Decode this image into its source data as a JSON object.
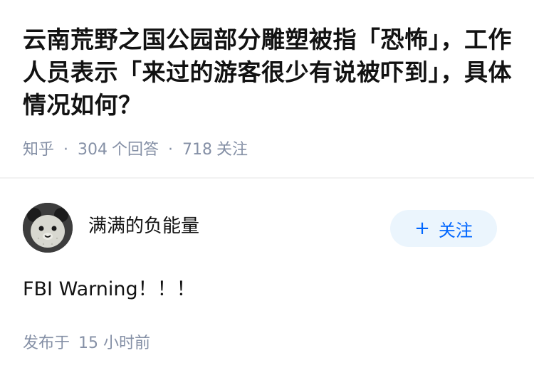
{
  "question": {
    "title": "云南荒野之国公园部分雕塑被指「恐怖」，工作人员表示「来过的游客很少有说被吓到」，具体情况如何？",
    "source": "知乎",
    "separator": "·",
    "answer_count": "304",
    "answer_label": "个回答",
    "follower_count": "718",
    "follower_label": "关注"
  },
  "answer": {
    "author": {
      "name": "满满的负能量",
      "avatar_icon": "panda-avatar"
    },
    "follow_button": {
      "icon": "+",
      "label": "关注"
    },
    "content": "FBI Warning！！！",
    "published_label": "发布于",
    "published_time": "15 小时前"
  },
  "colors": {
    "accent": "#0066ff",
    "follow_bg": "#ebf5fd",
    "meta_text": "#8590a6",
    "title_text": "#121212"
  }
}
